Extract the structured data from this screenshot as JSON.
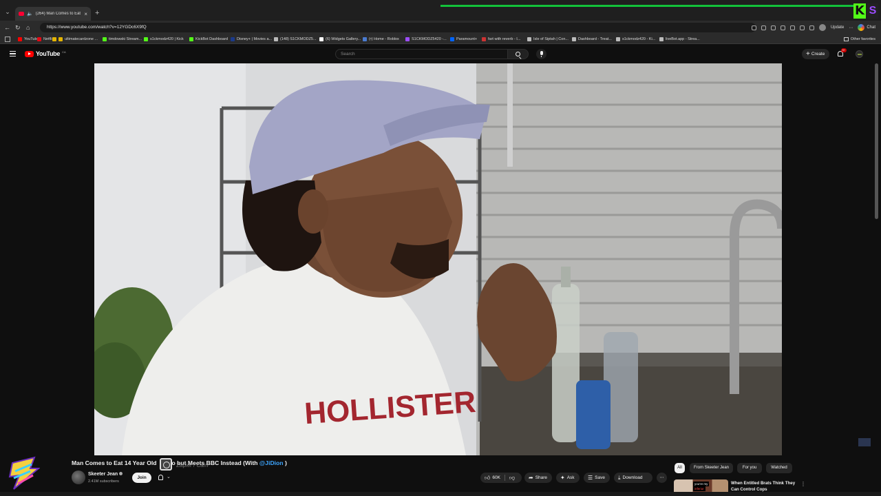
{
  "browser": {
    "tab_title": "(264) Man Comes to Eat 14 Y...",
    "url": "https://www.youtube.com/watch?v=12YGDc6X9fQ",
    "update_label": "Update",
    "chat_label": "Chat",
    "bookmarks": [
      {
        "label": "YouTube",
        "color": "#ff0000"
      },
      {
        "label": "Netflix",
        "color": "#e50914"
      },
      {
        "label": "",
        "color": "#e4b400"
      },
      {
        "label": "ultimatecardzone ...",
        "color": "#e4b400"
      },
      {
        "label": "timdowski Stream...",
        "color": "#53fc18"
      },
      {
        "label": "s1ckmodz420 | Kick",
        "color": "#53fc18"
      },
      {
        "label": "KickBot Dashboard",
        "color": "#53fc18"
      },
      {
        "label": "Disney+ | Movies a...",
        "color": "#1b3a8a"
      },
      {
        "label": "(148) S1CKMODZ5...",
        "color": "#bbbbbb"
      },
      {
        "label": "(6) Widgets Gallery...",
        "color": "#ffffff"
      },
      {
        "label": "(•) Home - Roblox",
        "color": "#4a7bd0"
      },
      {
        "label": "S1CKMODZ5420 -...",
        "color": "#9d4dff"
      },
      {
        "label": "Paramount+",
        "color": "#0064ff"
      },
      {
        "label": "fart with reverb - I...",
        "color": "#cc3333"
      },
      {
        "label": "Isle of Siptah | Con...",
        "color": "#bbbbbb"
      },
      {
        "label": "Dashboard - Treat...",
        "color": "#bbbbbb"
      },
      {
        "label": "s1ckmodz420 - Ki...",
        "color": "#bbbbbb"
      },
      {
        "label": "liveBot.app - Strea...",
        "color": "#bbbbbb"
      }
    ],
    "other_favorites": "Other favorites"
  },
  "header": {
    "logo_text": "YouTube",
    "logo_country": "CA",
    "search_placeholder": "Search",
    "create_label": "Create",
    "notification_count": "9+"
  },
  "video": {
    "title_main": "Man Comes to Eat 14 Year Old",
    "title_mid": "Taco but Meets BBC Instead (With ",
    "title_mention": "@JiDion",
    "title_end": ")",
    "overlay_text": "Zapier / Cam",
    "channel_name": "Skeeter Jean",
    "subscribers": "2.41M subscribers",
    "join_label": "Join"
  },
  "actions": {
    "likes": "60K",
    "share": "Share",
    "ask": "Ask",
    "save": "Save",
    "download": "Download"
  },
  "filters": [
    {
      "label": "All",
      "active": true
    },
    {
      "label": "From Skeeter Jean",
      "active": false
    },
    {
      "label": "For you",
      "active": false
    },
    {
      "label": "Watched",
      "active": false
    }
  ],
  "recommendation": {
    "title": "When Entitled Brats Think They Can Control Cops",
    "thumb_caption_1": "you're my",
    "thumb_caption_2": "inferior"
  }
}
